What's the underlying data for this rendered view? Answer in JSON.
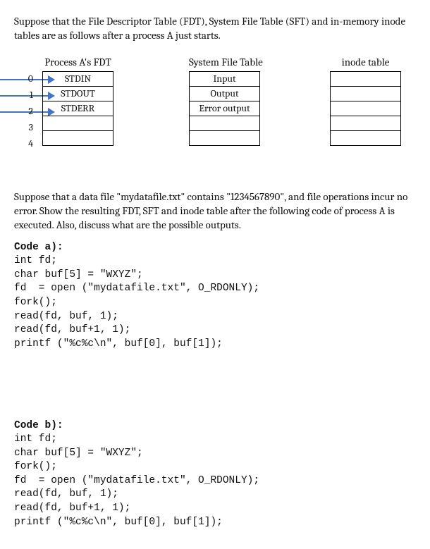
{
  "intro": "Suppose that the File Descriptor Table (FDT), System File Table (SFT) and in-memory inode tables are as follows after a process A just starts.",
  "tables": {
    "fdt": {
      "title": "Process A's FDT",
      "indices": [
        "0",
        "1",
        "2",
        "3",
        "4"
      ],
      "rows": [
        "STDIN",
        "STDOUT",
        "STDERR",
        "",
        ""
      ]
    },
    "sft": {
      "title": "System File Table",
      "rows": [
        "Input",
        "Output",
        "Error output",
        "",
        ""
      ]
    },
    "inode": {
      "title": "inode table",
      "rows": [
        "",
        "",
        "",
        "",
        ""
      ]
    }
  },
  "question": "Suppose that a data file \"mydatafile.txt\" contains \"1234567890\", and file operations incur no error. Show the resulting FDT, SFT and inode table after the following code of process A is executed. Also, discuss what are the possible outputs.",
  "code_a": {
    "heading": "Code a):",
    "body": "int fd;\nchar buf[5] = \"WXYZ\";\nfd  = open (\"mydatafile.txt\", O_RDONLY);\nfork();\nread(fd, buf, 1);\nread(fd, buf+1, 1);\nprintf (\"%c%c\\n\", buf[0], buf[1]);"
  },
  "code_b": {
    "heading": "Code b):",
    "body": "int fd;\nchar buf[5] = \"WXYZ\";\nfork();\nfd  = open (\"mydatafile.txt\", O_RDONLY);\nread(fd, buf, 1);\nread(fd, buf+1, 1);\nprintf (\"%c%c\\n\", buf[0], buf[1]);"
  }
}
